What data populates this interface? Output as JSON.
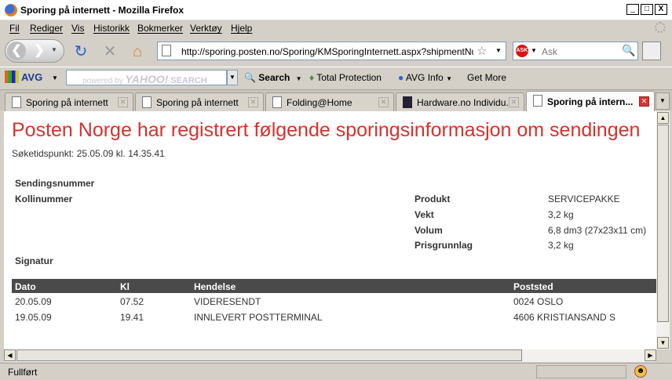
{
  "window": {
    "title": "Sporing på internett - Mozilla Firefox",
    "minimize": "_",
    "maximize": "□",
    "close": "X"
  },
  "menu": {
    "items": [
      "Fil",
      "Rediger",
      "Vis",
      "Historikk",
      "Bokmerker",
      "Verktøy",
      "Hjelp"
    ]
  },
  "navbar": {
    "url": "http://sporing.posten.no/Sporing/KMSporingInternett.aspx?shipmentNumber",
    "search_placeholder": "Ask",
    "search_engine_icon": "ask-icon"
  },
  "avg_toolbar": {
    "brand": "AVG",
    "search_placeholder_prefix": "powered by",
    "search_placeholder_brand": "YAHOO!",
    "search_placeholder_suffix": "SEARCH",
    "search_button": "Search",
    "total_protection": "Total Protection",
    "avg_info": "AVG Info",
    "get_more": "Get More"
  },
  "tabs": [
    {
      "label": "Sporing på internett",
      "active": false
    },
    {
      "label": "Sporing på internett",
      "active": false
    },
    {
      "label": "Folding@Home",
      "active": false
    },
    {
      "label": "Hardware.no Individu...",
      "active": false
    },
    {
      "label": "Sporing på intern...",
      "active": true
    }
  ],
  "page": {
    "heading": "Posten Norge har registrert følgende sporingsinformasjon om sendingen",
    "timestamp": "Søketidspunkt: 25.05.09 kl. 14.35.41",
    "left_labels": {
      "sendingsnummer": "Sendingsnummer",
      "kollinummer": "Kollinummer",
      "signatur": "Signatur"
    },
    "details": [
      {
        "label": "Produkt",
        "value": "SERVICEPAKKE"
      },
      {
        "label": "Vekt",
        "value": "3,2 kg"
      },
      {
        "label": "Volum",
        "value": "6,8 dm3 (27x23x11 cm)"
      },
      {
        "label": "Prisgrunnlag",
        "value": "3,2 kg"
      }
    ],
    "table": {
      "headers": [
        "Dato",
        "Kl",
        "Hendelse",
        "Poststed"
      ],
      "rows": [
        [
          "20.05.09",
          "07.52",
          "VIDERESENDT",
          "0024 OSLO"
        ],
        [
          "19.05.09",
          "19.41",
          "INNLEVERT POSTTERMINAL",
          "4606 KRISTIANSAND S"
        ]
      ]
    }
  },
  "status": {
    "text": "Fullført"
  }
}
